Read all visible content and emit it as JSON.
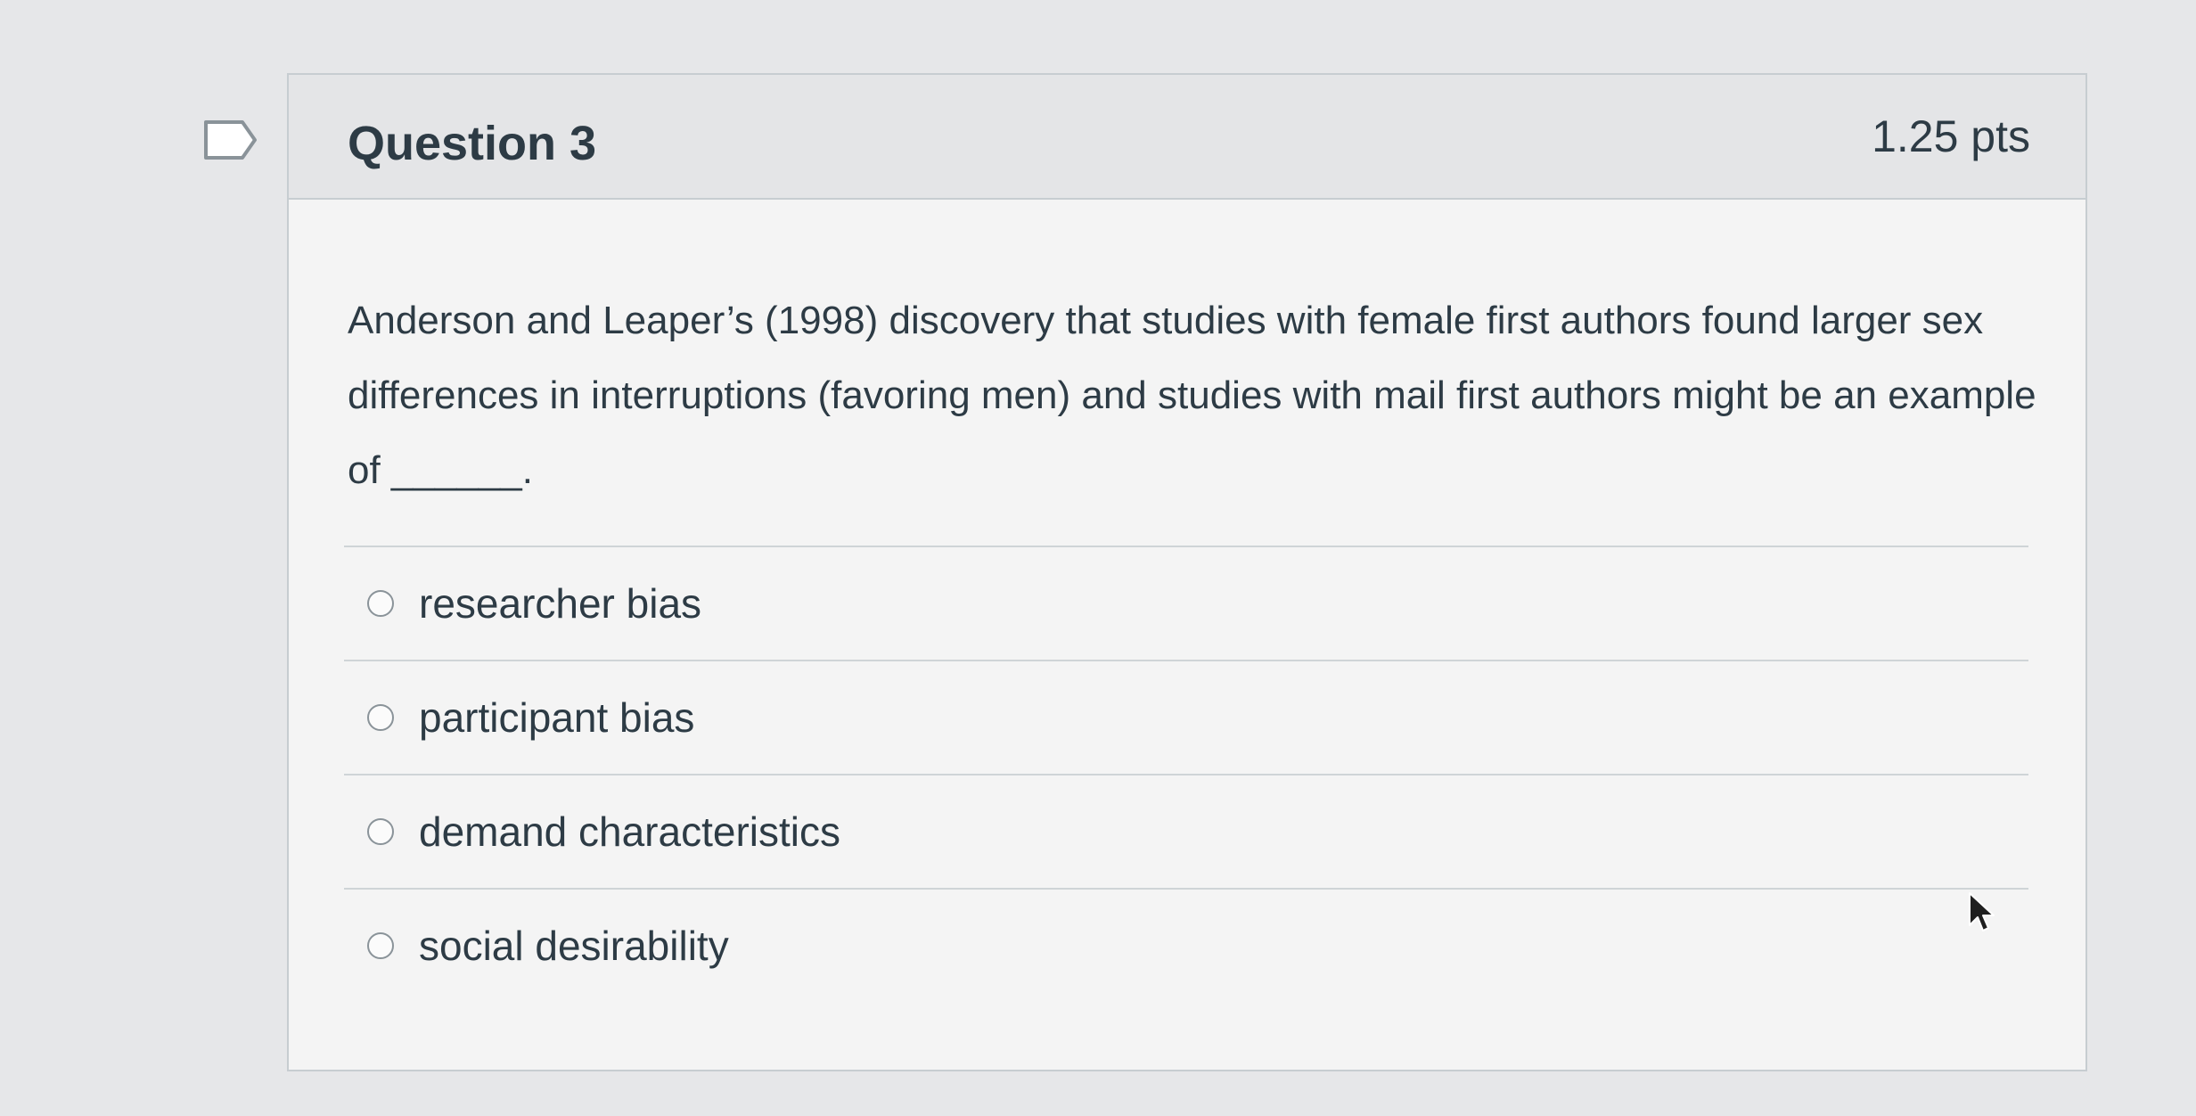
{
  "question": {
    "title": "Question 3",
    "points": "1.25 pts",
    "text": "Anderson and Leaper’s (1998) discovery that studies with female first authors found larger sex differences in interruptions (favoring men) and studies with mail first authors might be an example of ______.",
    "flag_icon": "flag-outline-icon"
  },
  "answers": [
    {
      "label": "researcher bias",
      "selected": false
    },
    {
      "label": "participant bias",
      "selected": false
    },
    {
      "label": "demand characteristics",
      "selected": false
    },
    {
      "label": "social desirability",
      "selected": false
    }
  ],
  "cursor_icon": "mouse-pointer-icon"
}
